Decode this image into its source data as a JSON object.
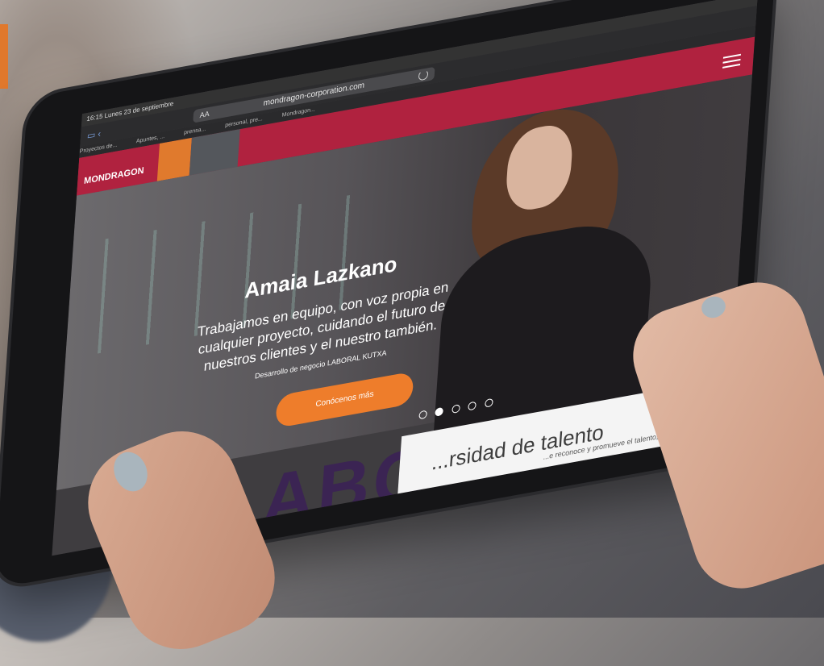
{
  "browser": {
    "status": "16:15  Lunes 23 de septiembre",
    "address_label": "AA",
    "url": "mondragon-corporation.com",
    "bookmarks": [
      "Proyectos de...",
      "Apuntes, ...",
      "prensa...",
      "personal, pre...",
      "Mondragon..."
    ]
  },
  "site": {
    "logo": "MONDRAGON",
    "hero": {
      "title": "Amaia Lazkano",
      "quote": "Trabajamos en equipo, con voz propia en cualquier proyecto, cuidando el futuro de nuestros clientes y el nuestro también.",
      "role": "Desarrollo de negocio LABORAL KUTXA",
      "cta": "Conócenos más",
      "slide_index": 1,
      "slide_count": 5
    },
    "bg_letters": "ABC",
    "section": {
      "title": "...rsidad de talento",
      "text": "...e reconoce y promueve el talento, ...distintos que nos hacen únicos."
    }
  },
  "colors": {
    "brand_red": "#b0223f",
    "brand_orange": "#ee7d2b"
  }
}
